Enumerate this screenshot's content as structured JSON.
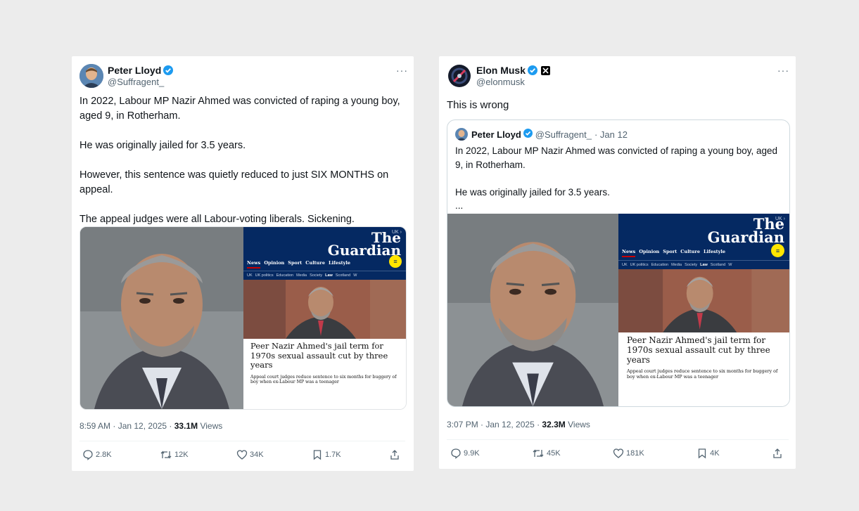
{
  "card1": {
    "author": {
      "name": "Peter Lloyd",
      "handle": "@Suffragent_"
    },
    "more_label": "···",
    "paragraphs": [
      "In 2022, Labour MP Nazir Ahmed was convicted of raping a young boy, aged 9, in Rotherham.",
      "He was originally jailed for 3.5 years.",
      "However, this sentence was quietly reduced to just SIX MONTHS on appeal.",
      "The appeal judges were all Labour-voting liberals. Sickening."
    ],
    "time": "8:59 AM · Jan 12, 2025 · ",
    "views_count": "33.1M",
    "views_label": " Views",
    "actions": {
      "replies": "2.8K",
      "reposts": "12K",
      "likes": "34K",
      "bookmarks": "1.7K"
    }
  },
  "card2": {
    "author": {
      "name": "Elon Musk",
      "handle": "@elonmusk"
    },
    "more_label": "···",
    "text": "This is wrong",
    "quote": {
      "name": "Peter Lloyd",
      "handle": "@Suffragent_",
      "date": "· Jan 12",
      "paragraphs": [
        "In 2022, Labour MP Nazir Ahmed was convicted of raping a young boy, aged 9, in Rotherham.",
        "He was originally jailed for 3.5 years.",
        "..."
      ]
    },
    "time": "3:07 PM · Jan 12, 2025 · ",
    "views_count": "32.3M",
    "views_label": " Views",
    "actions": {
      "replies": "9.9K",
      "reposts": "45K",
      "likes": "181K",
      "bookmarks": "4K"
    }
  },
  "guardian": {
    "uk": "UK ›",
    "logo_line1": "The",
    "logo_line2": "Guardian",
    "nav": [
      "News",
      "Opinion",
      "Sport",
      "Culture",
      "Lifestyle"
    ],
    "subnav": [
      "UK",
      "UK politics",
      "Education",
      "Media",
      "Society",
      "Law",
      "Scotland",
      "W"
    ],
    "headline": "Peer Nazir Ahmed's jail term for 1970s sexual assault cut by three years",
    "standfirst": "Appeal court judges reduce sentence to six months for buggery of boy when ex-Labour MP was a teenager"
  },
  "colors": {
    "verified": "#1d9bf0",
    "guardian_blue": "#052962",
    "guardian_yellow": "#ffe500",
    "news_red": "#c70000"
  },
  "icons": [
    "verified-badge-icon",
    "x-logo-icon",
    "more-icon",
    "reply-icon",
    "repost-icon",
    "like-icon",
    "bookmark-icon",
    "share-icon",
    "menu-icon"
  ]
}
